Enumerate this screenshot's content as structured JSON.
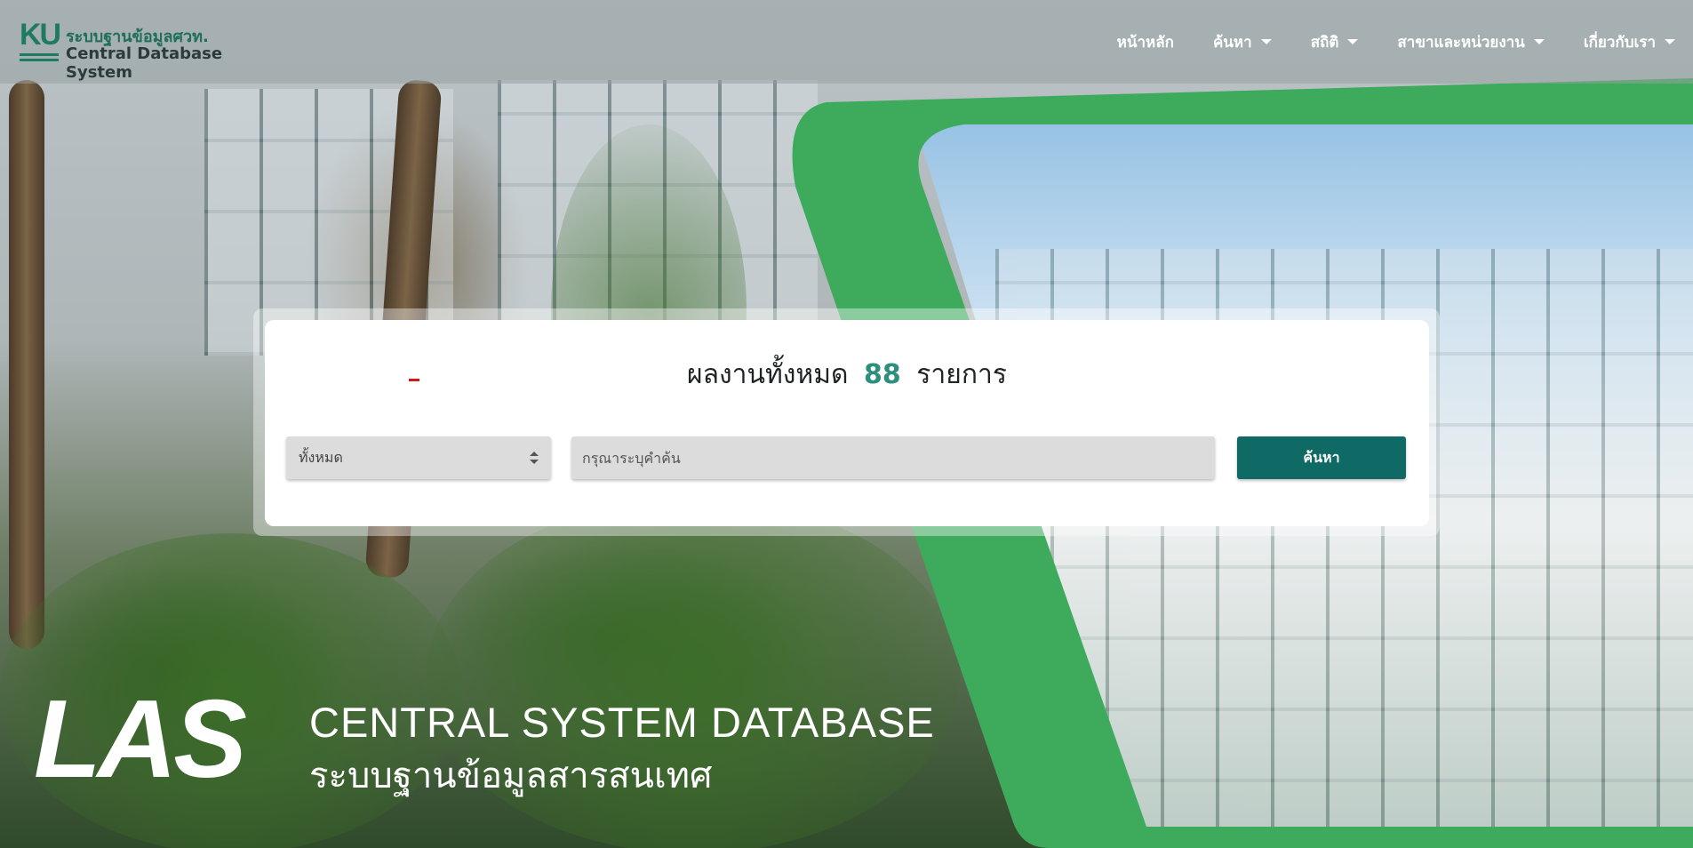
{
  "logo": {
    "mark": "KU",
    "title_th": "ระบบฐานข้อมูลศวท.",
    "title_en": "Central Database System"
  },
  "nav": {
    "items": [
      {
        "label": "หน้าหลัก",
        "dropdown": false
      },
      {
        "label": "ค้นหา",
        "dropdown": true
      },
      {
        "label": "สถิติ",
        "dropdown": true
      },
      {
        "label": "สาขาและหน่วยงาน",
        "dropdown": true
      },
      {
        "label": "เกี่ยวกับเรา",
        "dropdown": true
      }
    ]
  },
  "search": {
    "headline_prefix": "ผลงานทั้งหมด",
    "count": "88",
    "headline_suffix": "รายการ",
    "category_selected": "ทั้งหมด",
    "input_placeholder": "กรุณาระบุคำค้น",
    "input_value": "",
    "button_label": "ค้นหา"
  },
  "hero": {
    "brand": "LAS",
    "tagline_en": "CENTRAL SYSTEM DATABASE",
    "tagline_th": "ระบบฐานข้อมูลสารสนเทศ"
  },
  "colors": {
    "accent_green": "#3daa5c",
    "button_teal": "#0f6a66",
    "count_teal": "#2f8f7f",
    "logo_green": "#1f7a63"
  }
}
